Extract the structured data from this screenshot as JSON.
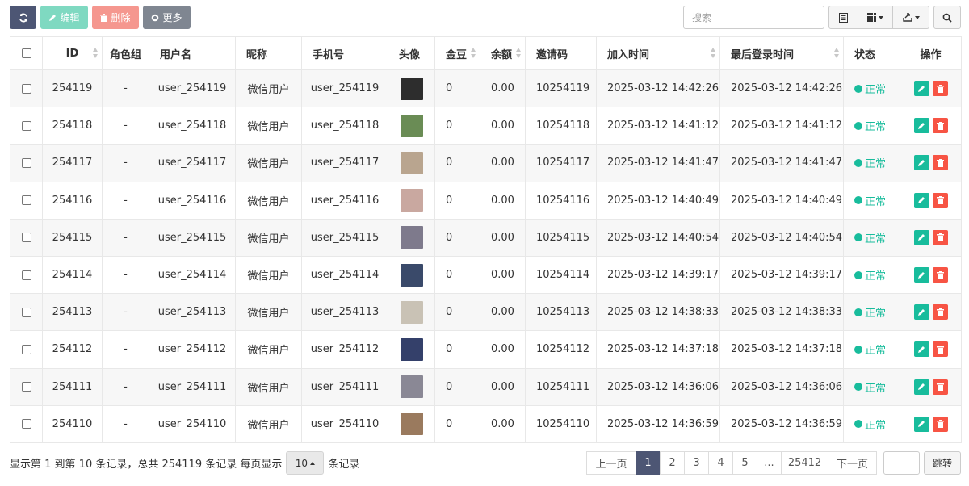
{
  "toolbar": {
    "refresh_icon": "refresh-icon",
    "edit_label": "编辑",
    "delete_label": "删除",
    "more_label": "更多",
    "search_placeholder": "搜索"
  },
  "table": {
    "headers": {
      "id": "ID",
      "role_group": "角色组",
      "username": "用户名",
      "nickname": "昵称",
      "mobile": "手机号",
      "avatar": "头像",
      "gold": "金豆",
      "balance": "余额",
      "invite_code": "邀请码",
      "join_time": "加入时间",
      "last_login": "最后登录时间",
      "status": "状态",
      "actions": "操作"
    },
    "rows": [
      {
        "id": "254119",
        "role_group": "-",
        "username": "user_254119",
        "nickname": "微信用户",
        "mobile": "user_254119",
        "avatar_color": "#2d2d2d",
        "gold": "0",
        "balance": "0.00",
        "invite_code": "10254119",
        "join_time": "2025-03-12 14:42:26",
        "last_login": "2025-03-12 14:42:26",
        "status": "正常"
      },
      {
        "id": "254118",
        "role_group": "-",
        "username": "user_254118",
        "nickname": "微信用户",
        "mobile": "user_254118",
        "avatar_color": "#6a8c55",
        "gold": "0",
        "balance": "0.00",
        "invite_code": "10254118",
        "join_time": "2025-03-12 14:41:12",
        "last_login": "2025-03-12 14:41:12",
        "status": "正常"
      },
      {
        "id": "254117",
        "role_group": "-",
        "username": "user_254117",
        "nickname": "微信用户",
        "mobile": "user_254117",
        "avatar_color": "#b9a58f",
        "gold": "0",
        "balance": "0.00",
        "invite_code": "10254117",
        "join_time": "2025-03-12 14:41:47",
        "last_login": "2025-03-12 14:41:47",
        "status": "正常"
      },
      {
        "id": "254116",
        "role_group": "-",
        "username": "user_254116",
        "nickname": "微信用户",
        "mobile": "user_254116",
        "avatar_color": "#c9a8a0",
        "gold": "0",
        "balance": "0.00",
        "invite_code": "10254116",
        "join_time": "2025-03-12 14:40:49",
        "last_login": "2025-03-12 14:40:49",
        "status": "正常"
      },
      {
        "id": "254115",
        "role_group": "-",
        "username": "user_254115",
        "nickname": "微信用户",
        "mobile": "user_254115",
        "avatar_color": "#7e7a8c",
        "gold": "0",
        "balance": "0.00",
        "invite_code": "10254115",
        "join_time": "2025-03-12 14:40:54",
        "last_login": "2025-03-12 14:40:54",
        "status": "正常"
      },
      {
        "id": "254114",
        "role_group": "-",
        "username": "user_254114",
        "nickname": "微信用户",
        "mobile": "user_254114",
        "avatar_color": "#3a4a6a",
        "gold": "0",
        "balance": "0.00",
        "invite_code": "10254114",
        "join_time": "2025-03-12 14:39:17",
        "last_login": "2025-03-12 14:39:17",
        "status": "正常"
      },
      {
        "id": "254113",
        "role_group": "-",
        "username": "user_254113",
        "nickname": "微信用户",
        "mobile": "user_254113",
        "avatar_color": "#c9c2b5",
        "gold": "0",
        "balance": "0.00",
        "invite_code": "10254113",
        "join_time": "2025-03-12 14:38:33",
        "last_login": "2025-03-12 14:38:33",
        "status": "正常"
      },
      {
        "id": "254112",
        "role_group": "-",
        "username": "user_254112",
        "nickname": "微信用户",
        "mobile": "user_254112",
        "avatar_color": "#34406a",
        "gold": "0",
        "balance": "0.00",
        "invite_code": "10254112",
        "join_time": "2025-03-12 14:37:18",
        "last_login": "2025-03-12 14:37:18",
        "status": "正常"
      },
      {
        "id": "254111",
        "role_group": "-",
        "username": "user_254111",
        "nickname": "微信用户",
        "mobile": "user_254111",
        "avatar_color": "#8a8895",
        "gold": "0",
        "balance": "0.00",
        "invite_code": "10254111",
        "join_time": "2025-03-12 14:36:06",
        "last_login": "2025-03-12 14:36:06",
        "status": "正常"
      },
      {
        "id": "254110",
        "role_group": "-",
        "username": "user_254110",
        "nickname": "微信用户",
        "mobile": "user_254110",
        "avatar_color": "#9a7a5e",
        "gold": "0",
        "balance": "0.00",
        "invite_code": "10254110",
        "join_time": "2025-03-12 14:36:59",
        "last_login": "2025-03-12 14:36:59",
        "status": "正常"
      }
    ]
  },
  "footer": {
    "info_text": "显示第 1 到第 10 条记录，总共 254119 条记录 每页显示",
    "page_size": "10",
    "records_suffix": "条记录",
    "prev": "上一页",
    "pages": [
      "1",
      "2",
      "3",
      "4",
      "5",
      "...",
      "25412"
    ],
    "next": "下一页",
    "jump_label": "跳转"
  },
  "colors": {
    "primary": "#4d5674",
    "success": "#18bc9c",
    "danger": "#f75444"
  }
}
